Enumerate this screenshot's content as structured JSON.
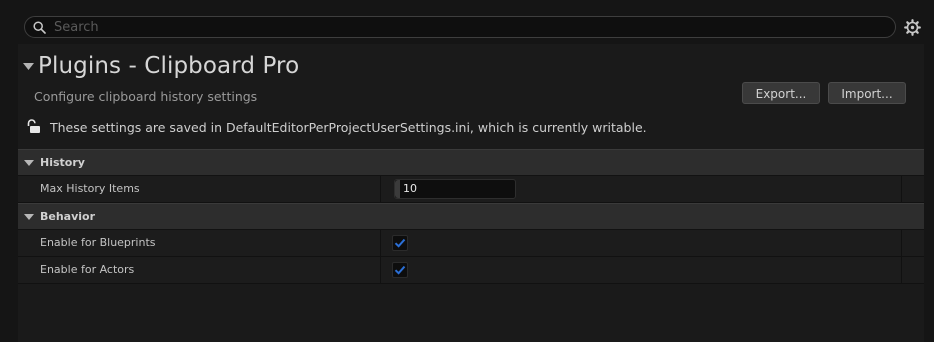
{
  "search": {
    "placeholder": "Search"
  },
  "header": {
    "title": "Plugins - Clipboard Pro",
    "subtitle": "Configure clipboard history settings",
    "export_label": "Export...",
    "import_label": "Import...",
    "config_note": "These settings are saved in DefaultEditorPerProjectUserSettings.ini, which is currently writable."
  },
  "categories": [
    {
      "label": "History",
      "rows": [
        {
          "label": "Max History Items",
          "value": "10"
        }
      ]
    },
    {
      "label": "Behavior",
      "rows": [
        {
          "label": "Enable for Blueprints",
          "checked": true
        },
        {
          "label": "Enable for Actors",
          "checked": true
        }
      ]
    }
  ],
  "colors": {
    "accent": "#2b6fd6",
    "background": "#151515",
    "panel": "#1a1a1a",
    "category": "#2d2d2d"
  },
  "icons": {
    "search": "search-icon",
    "settings": "gear-icon",
    "lock": "unlocked-padlock-icon",
    "expand": "triangle-down-icon",
    "check": "checkmark-icon"
  }
}
